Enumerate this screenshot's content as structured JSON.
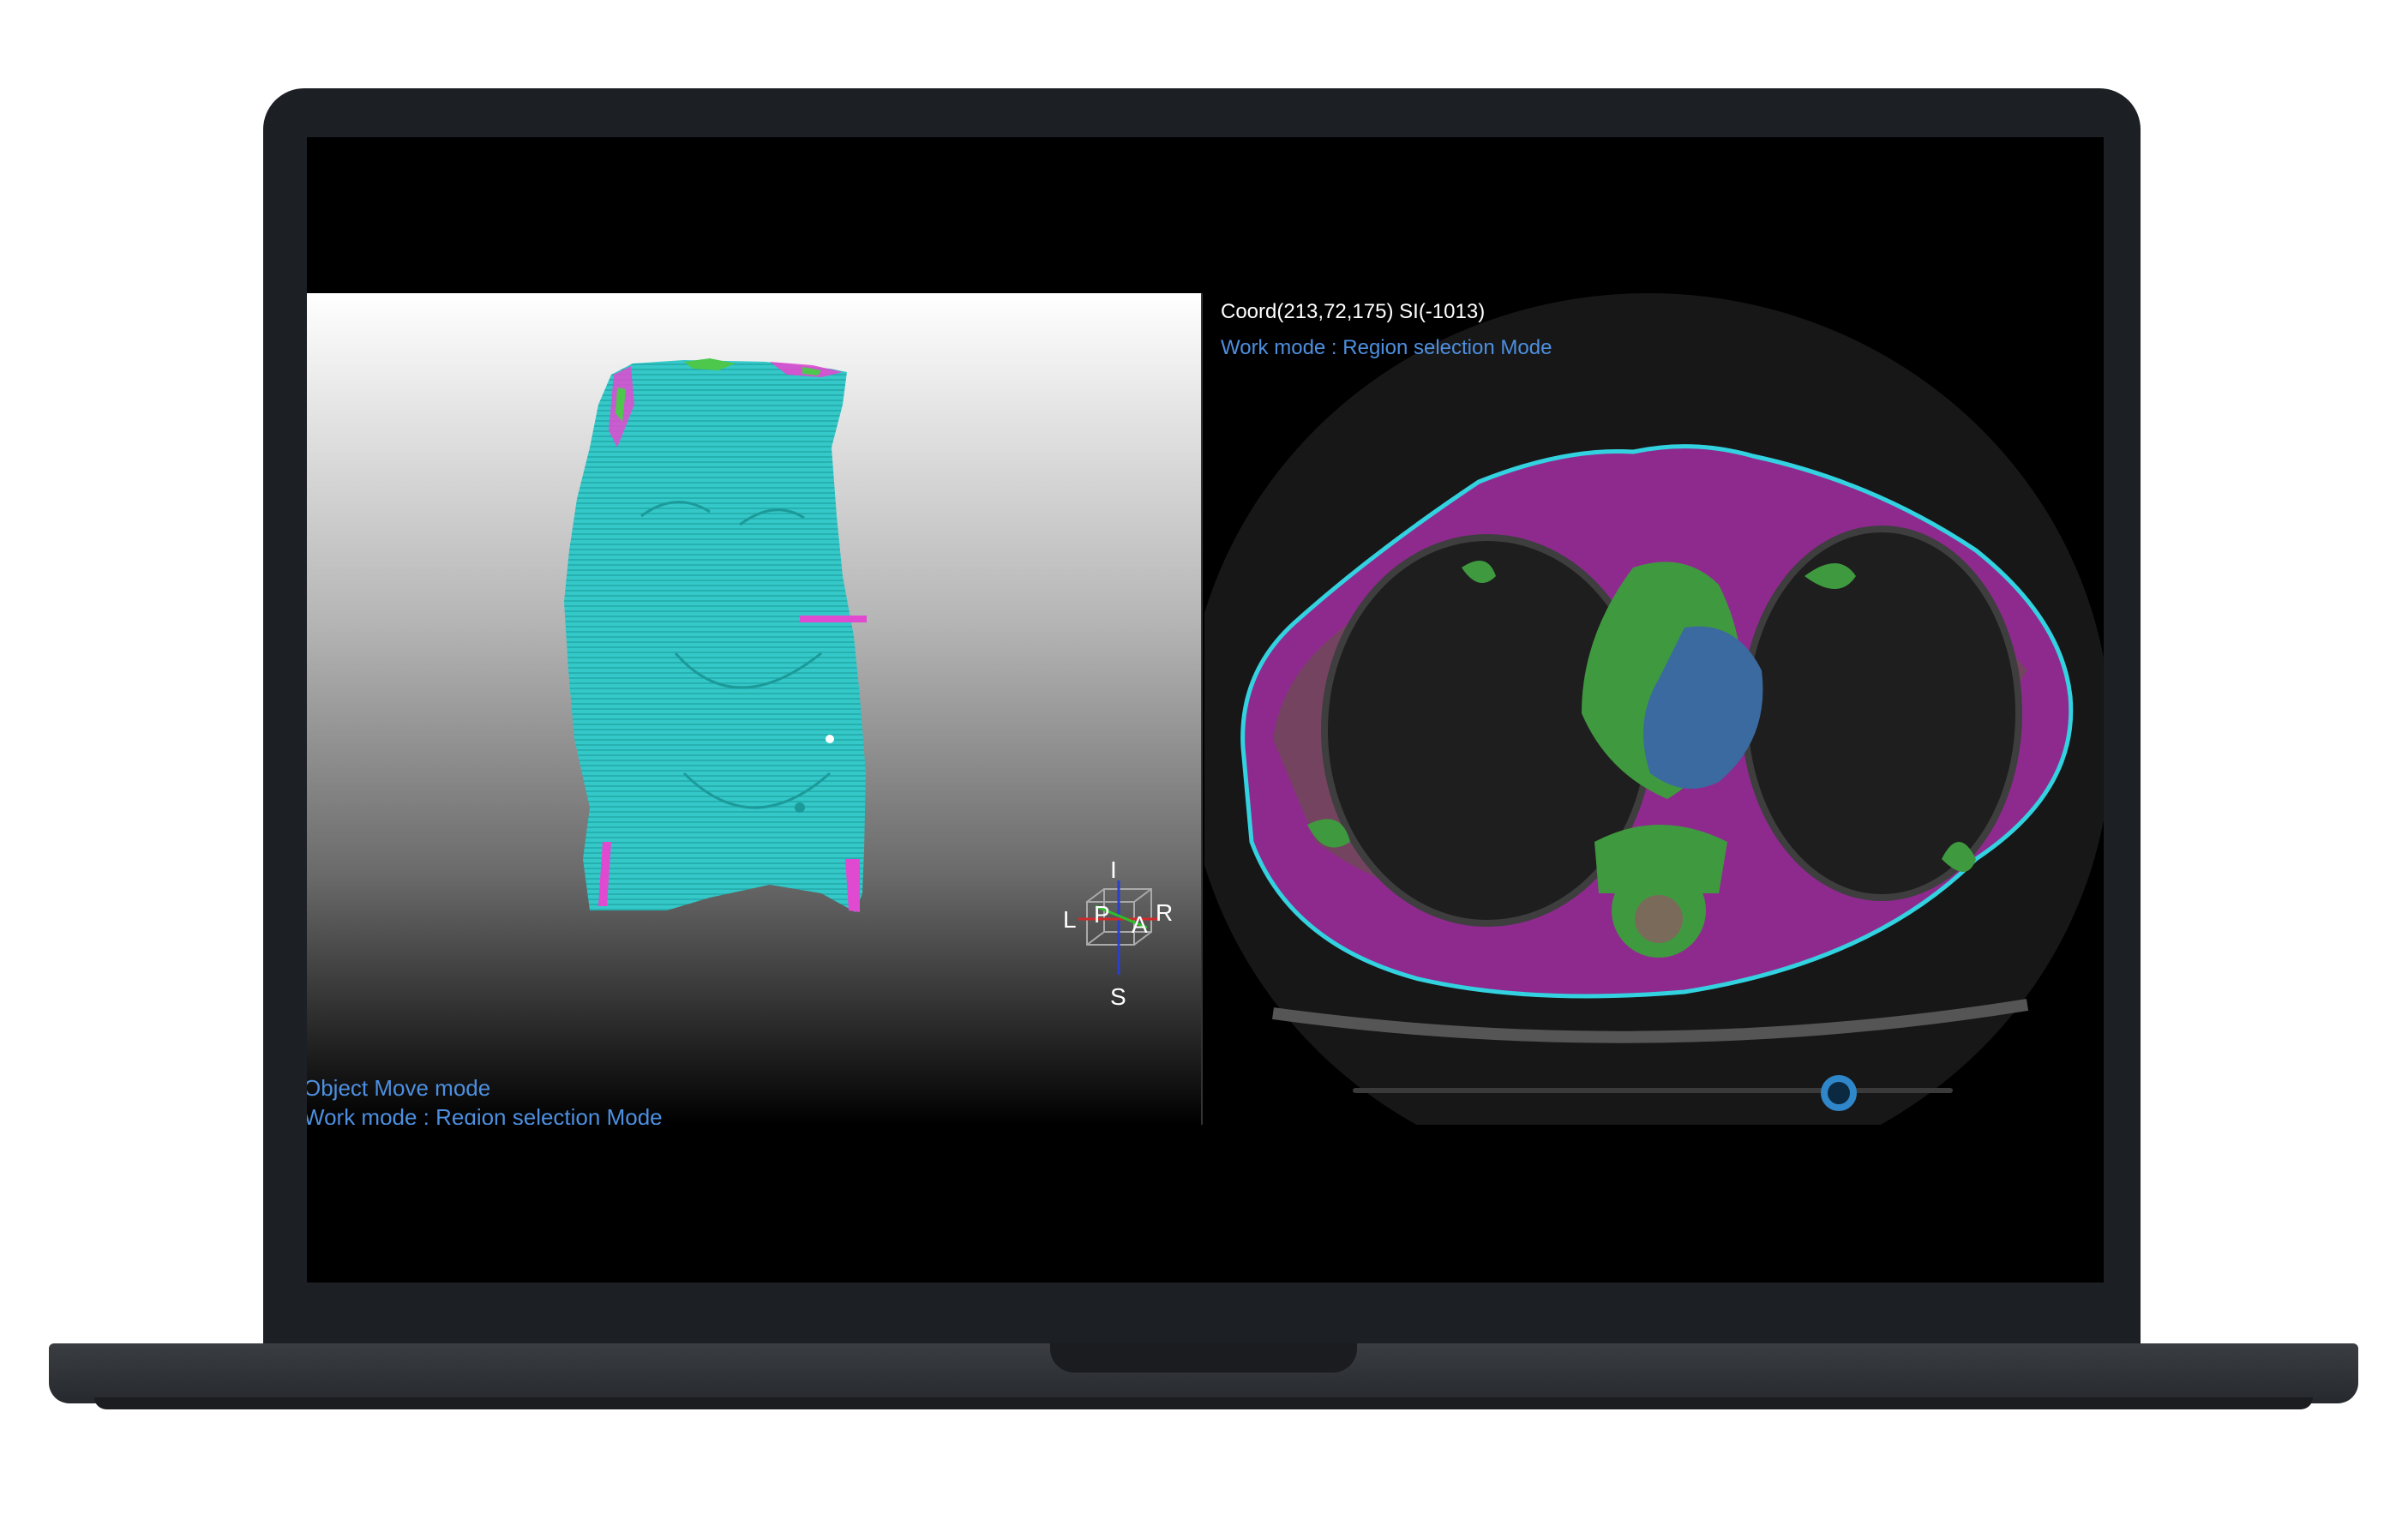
{
  "viewer_3d": {
    "status_line_1": "Object Move mode",
    "status_line_2": "Work mode : Region selection Mode",
    "orientation": {
      "top": "I",
      "bottom": "S",
      "left": "L",
      "right": "R",
      "back": "P",
      "front": "A"
    }
  },
  "viewer_ct": {
    "coord_text": "Coord(213,72,175) SI(-1013)",
    "work_mode_text": "Work mode : Region selection Mode",
    "slice_slider_value": 0.81
  },
  "colors": {
    "skin_surface": "#33c6c6",
    "muscle": "#8e2a8e",
    "organ": "#3f9a3f",
    "vessel": "#3a6aa0",
    "fat": "#6e4a55",
    "accent": "#2f86c8"
  }
}
